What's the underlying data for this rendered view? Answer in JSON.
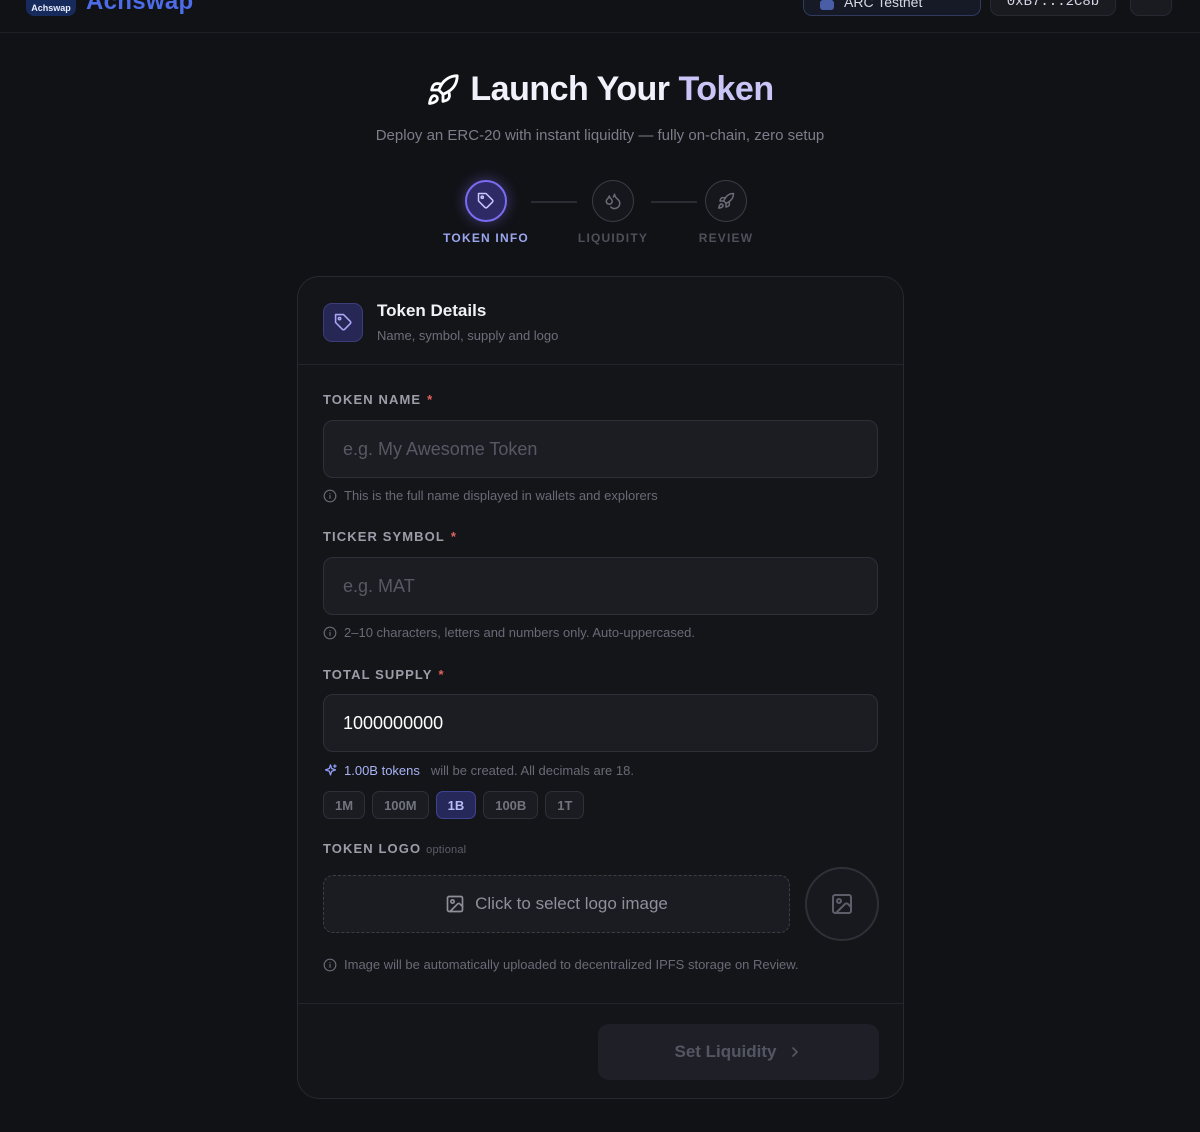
{
  "header": {
    "logo_badge": "Achswap",
    "brand": "Achswap",
    "network_label": "ARC Testnet",
    "wallet_address": "0xB7...2C8b"
  },
  "hero": {
    "title_main": "Launch Your",
    "title_accent": "Token",
    "subtitle": "Deploy an ERC-20 with instant liquidity — fully on-chain, zero setup",
    "accent_color": "#7a6cf0"
  },
  "stepper": {
    "steps": [
      {
        "label": "TOKEN INFO",
        "icon": "tag-icon",
        "state": "active"
      },
      {
        "label": "LIQUIDITY",
        "icon": "droplet-icon",
        "state": "inactive"
      },
      {
        "label": "REVIEW",
        "icon": "rocket-icon",
        "state": "inactive"
      }
    ]
  },
  "card": {
    "title": "Token Details",
    "subtitle": "Name, symbol, supply and logo",
    "fields": {
      "name": {
        "label": "TOKEN NAME",
        "required": "*",
        "placeholder": "e.g. My Awesome Token",
        "value": "",
        "hint": "This is the full name displayed in wallets and explorers"
      },
      "symbol": {
        "label": "TICKER SYMBOL",
        "required": "*",
        "placeholder": "e.g. MAT",
        "value": "",
        "hint": "2–10 characters, letters and numbers only. Auto-uppercased."
      },
      "supply": {
        "label": "TOTAL SUPPLY",
        "required": "*",
        "value": "1000000000",
        "note_highlight": "1.00B tokens",
        "note_rest": "will be created. All decimals are 18.",
        "presets": [
          "1M",
          "100M",
          "1B",
          "100B",
          "1T"
        ],
        "selected_preset": "1B"
      },
      "logo": {
        "label": "TOKEN LOGO",
        "optional": "optional",
        "upload_label": "Click to select logo image",
        "hint": "Image will be automatically uploaded to decentralized IPFS storage on Review."
      }
    },
    "next_button": "Set Liquidity"
  }
}
